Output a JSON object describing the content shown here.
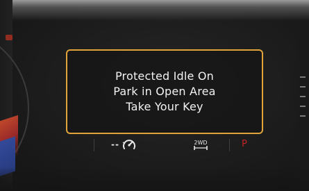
{
  "message": {
    "lines": [
      "Protected Idle On",
      "Park in Open Area",
      "Take Your Key"
    ],
    "border_color": "#e1a43a"
  },
  "status_bar": {
    "cruise_speed_text": "--",
    "cruise_icon": "cruise-control-icon",
    "drive_mode_label": "2WD",
    "drive_mode_icon": "axle-icon",
    "gear": "P",
    "gear_color": "#c22424"
  }
}
